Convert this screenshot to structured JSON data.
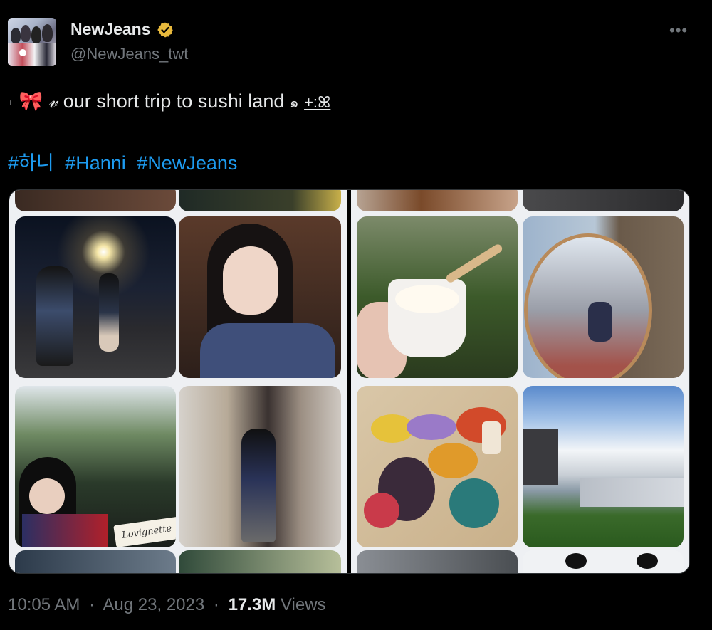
{
  "account": {
    "name": "NewJeans",
    "handle": "@NewJeans_twt",
    "verified_color": "#e8b93c"
  },
  "menu": {
    "more_label": "•••"
  },
  "tweet": {
    "plus": "+",
    "bow_emoji": "🎀",
    "script_v": "𝓋",
    "text": " our short trip to sushi land ",
    "swirl": "๑",
    "tail": "+:ꕤ",
    "hashtags": [
      "#하니",
      "#Hanni",
      "#NewJeans"
    ]
  },
  "media": {
    "caption_text": "Lovignette"
  },
  "footer": {
    "time": "10:05 AM",
    "dot": "·",
    "date": "Aug 23, 2023",
    "views_count": "17.3M",
    "views_label": "Views"
  },
  "colors": {
    "background": "#000000",
    "text": "#e7e9ea",
    "muted": "#71767b",
    "link": "#1d9bf0"
  }
}
